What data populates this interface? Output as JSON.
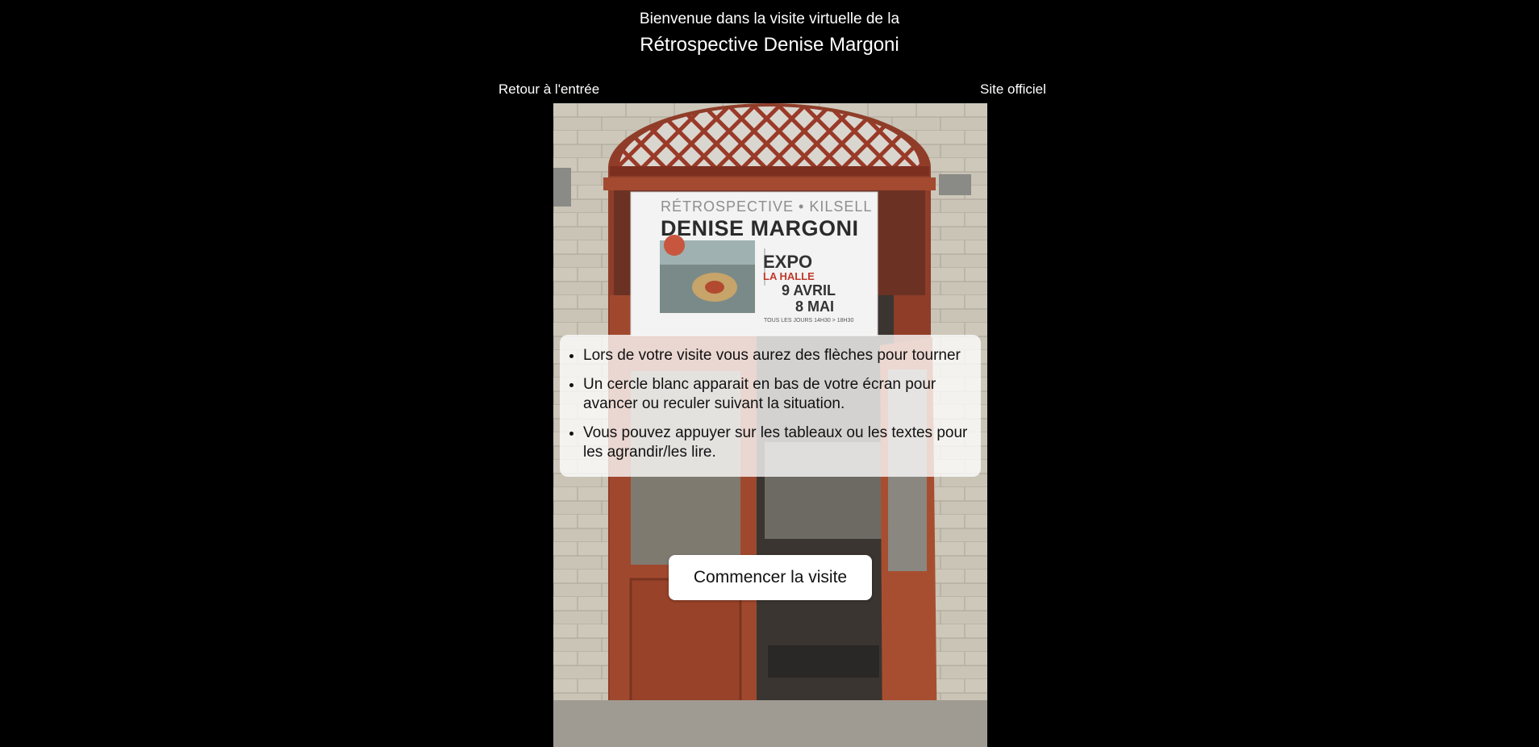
{
  "header": {
    "subtitle": "Bienvenue dans la visite virtuelle de la",
    "title": "Rétrospective Denise Margoni"
  },
  "nav": {
    "back_label": "Retour à l'entrée",
    "official_label": "Site officiel"
  },
  "banner": {
    "top_line": "RÉTROSPECTIVE • KILSELL",
    "name": "DENISE MARGONI",
    "expo": "EXPO",
    "venue": "LA HALLE",
    "date_start": "9 AVRIL",
    "date_end": "8 MAI",
    "hours": "TOUS LES JOURS 14H30 > 18H30"
  },
  "instructions": [
    "Lors de votre visite vous aurez des flèches pour tourner",
    "Un cercle blanc apparait en bas de votre écran pour avancer ou reculer suivant la situation.",
    "Vous pouvez appuyer sur les tableaux ou les textes pour les agrandir/les lire."
  ],
  "start_button": "Commencer la visite",
  "colors": {
    "background": "#000000",
    "door": "#a0482e",
    "stone": "#c6c1b3"
  }
}
